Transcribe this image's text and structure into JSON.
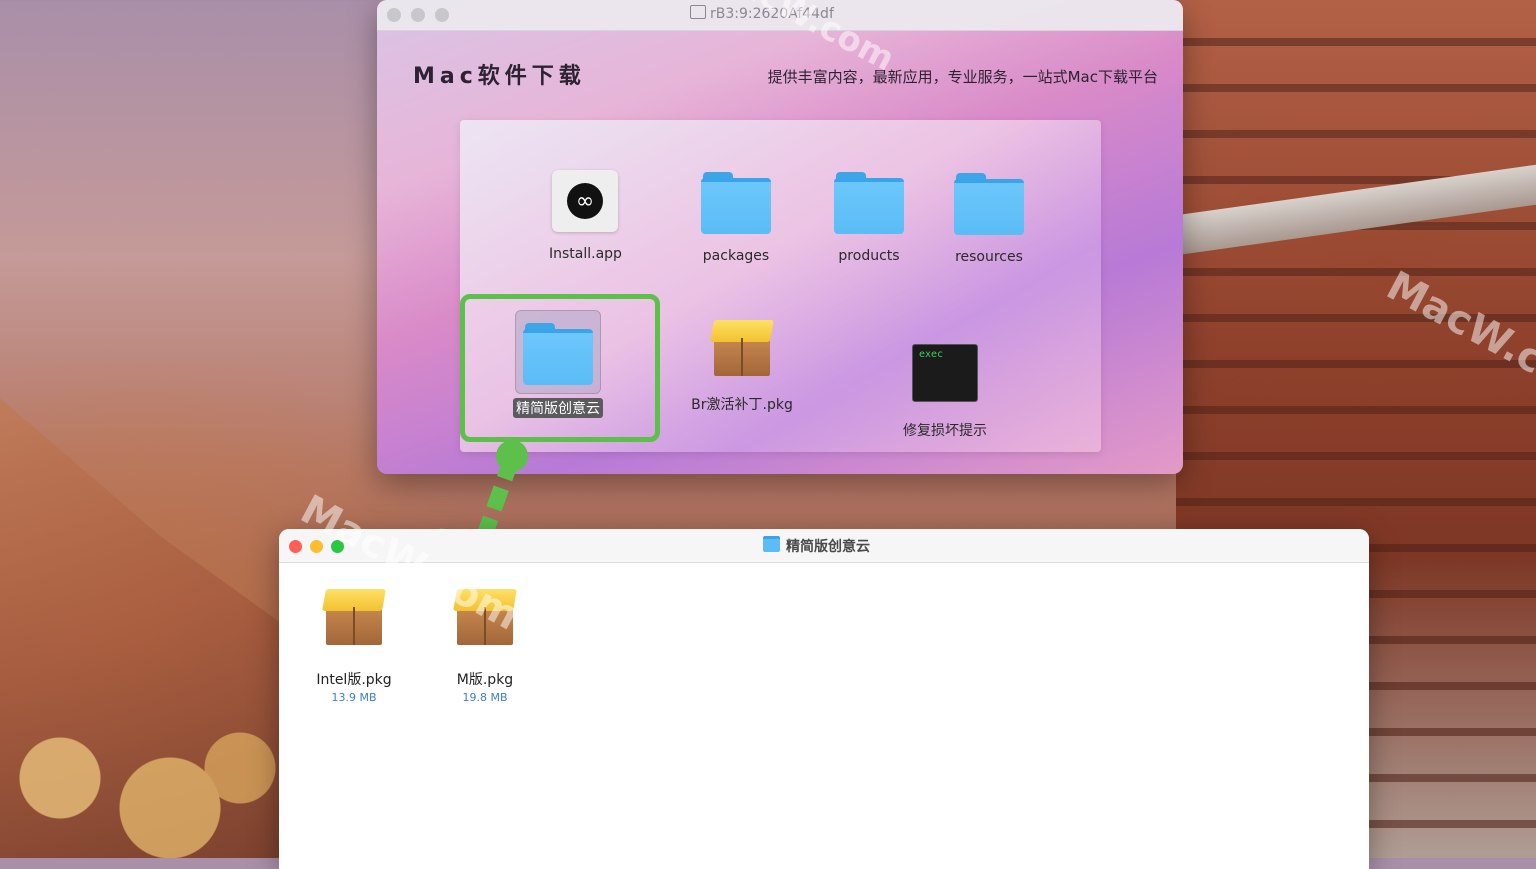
{
  "dmg_window": {
    "title": "rB3:9:2620Af44df",
    "heading": "Mac软件下载",
    "tagline": "提供丰富内容，最新应用，专业服务，一站式Mac下载平台",
    "items": [
      {
        "label": "Install.app",
        "icon": "creative-cloud-app-icon"
      },
      {
        "label": "packages",
        "icon": "folder-icon"
      },
      {
        "label": "products",
        "icon": "folder-icon"
      },
      {
        "label": "resources",
        "icon": "folder-icon"
      },
      {
        "label": "精简版创意云",
        "icon": "folder-icon",
        "selected": true
      },
      {
        "label": "Br激活补丁.pkg",
        "icon": "package-icon"
      },
      {
        "label": "修复损坏提示",
        "icon": "terminal-exec-icon",
        "icon_text": "exec"
      }
    ],
    "highlight_color": "#5cc04a"
  },
  "finder_window": {
    "title": "精简版创意云",
    "items": [
      {
        "label": "Intel版.pkg",
        "size": "13.9 MB",
        "icon": "package-icon"
      },
      {
        "label": "M版.pkg",
        "size": "19.8 MB",
        "icon": "package-icon"
      }
    ],
    "window_buttons": {
      "close": "#ff5f57",
      "minimize": "#febc2e",
      "zoom": "#28c840"
    }
  },
  "watermarks": [
    "MacW.com",
    "MacW.com",
    "MacW.c"
  ]
}
